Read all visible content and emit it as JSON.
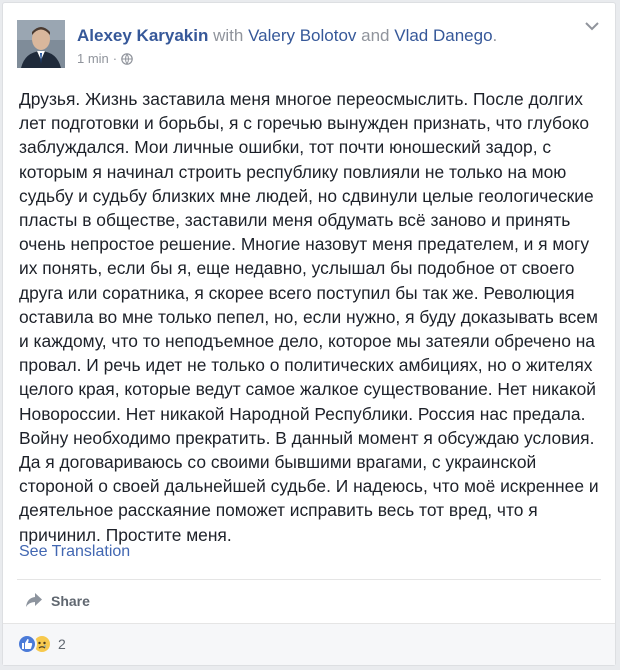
{
  "post": {
    "author": "Alexey Karyakin",
    "with_text": " with ",
    "tagged_1": "Valery Bolotov",
    "and_text": " and ",
    "tagged_2": "Vlad Danego",
    "period": ".",
    "time": "1 min",
    "dot": "·",
    "privacy_icon": "globe-icon",
    "menu_icon": "chevron-down-icon",
    "text": "Друзья. Жизнь заставила меня многое переосмыслить. После долгих лет подготовки и борьбы, я с горечью вынужден признать, что глубоко заблуждался. Мои личные ошибки, тот почти юношеский задор, с которым я начинал строить республику повлияли не только на мою судьбу и судьбу близких мне людей, но сдвинули целые геологические пласты в обществе, заставили меня обдумать всё заново и принять очень непростое решение. Многие назовут меня предателем, и я могу их понять, если бы я, еще недавно, услышал бы подобное от своего друга или соратника, я скорее всего поступил бы так же. Революция оставила во мне только пепел, но, если нужно, я буду доказывать всем и каждому, что то неподъемное дело, которое мы затеяли обречено на провал. И речь идет не только о политических амбициях, но о жителях целого края, которые ведут самое жалкое существование. Нет никакой Новороссии. Нет никакой Народной Республики. Россия нас предала. Войну необходимо прекратить. В данный момент я обсуждаю условия. Да я договариваюсь со своими бывшими врагами, с украинской стороной о своей дальнейшей судьбе. И надеюсь, что моё искреннее и деятельное расскаяние поможет исправить весь тот вред, что я причинил. Простите меня.",
    "see_translation": "See Translation"
  },
  "actions": {
    "share_label": "Share",
    "share_icon": "share-arrow-icon"
  },
  "reactions": {
    "icons": [
      "like-icon",
      "sad-icon"
    ],
    "count": "2"
  },
  "colors": {
    "link": "#365899",
    "translation": "#4267b2",
    "meta": "#90949c",
    "text": "#1d2129"
  }
}
